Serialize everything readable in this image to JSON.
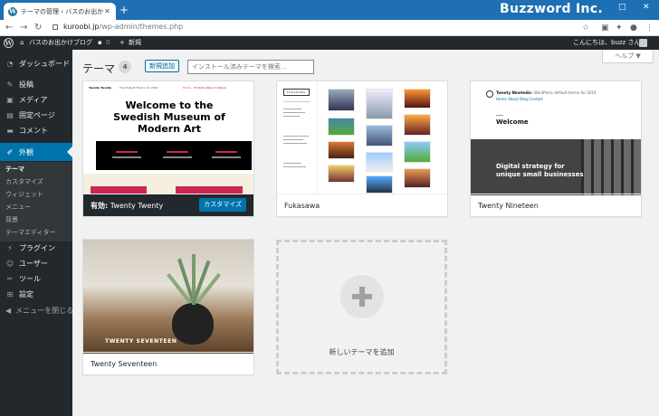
{
  "browser": {
    "tab_title": "テーマの管理 ‹ バスのお出かけブログ",
    "tab_close": "✕",
    "new_tab": "+",
    "watermark": "Buzzword Inc.",
    "url_host": "kuroobi.jp",
    "url_path": "/wp-admin/themes.php",
    "window_controls": [
      "–",
      "□",
      "✕"
    ],
    "nav_icons": [
      "back-arrow",
      "forward-arrow",
      "reload"
    ],
    "right_icons": [
      "star",
      "screenshot",
      "puzzle",
      "account",
      "kebab"
    ]
  },
  "adminbar": {
    "site_name": "バスのお出かけブログ",
    "comments_count": "0",
    "new_label": "新規",
    "greeting": "こんにちは、buzz さん"
  },
  "sidebar": {
    "items": [
      {
        "icon": "dashboard-icon",
        "glyph": "◔",
        "label": "ダッシュボード"
      },
      {
        "icon": "pin-icon",
        "glyph": "✎",
        "label": "投稿"
      },
      {
        "icon": "media-icon",
        "glyph": "▣",
        "label": "メディア"
      },
      {
        "icon": "pages-icon",
        "glyph": "▤",
        "label": "固定ページ"
      },
      {
        "icon": "comment-icon",
        "glyph": "▬",
        "label": "コメント"
      },
      {
        "icon": "brush-icon",
        "glyph": "✐",
        "label": "外観"
      },
      {
        "icon": "plugin-icon",
        "glyph": "⚡",
        "label": "プラグイン"
      },
      {
        "icon": "users-icon",
        "glyph": "☺",
        "label": "ユーザー"
      },
      {
        "icon": "tools-icon",
        "glyph": "✂",
        "label": "ツール"
      },
      {
        "icon": "settings-icon",
        "glyph": "⊞",
        "label": "設定"
      },
      {
        "icon": "collapse-icon",
        "glyph": "◀",
        "label": "メニューを閉じる"
      }
    ],
    "submenu": [
      "テーマ",
      "カスタマイズ",
      "ウィジェット",
      "メニュー",
      "背景",
      "テーマエディター"
    ]
  },
  "header": {
    "title": "テーマ",
    "count": "4",
    "add_new": "新規追加",
    "search_placeholder": "インストール済みテーマを検索...",
    "help": "ヘルプ ▼"
  },
  "themes": [
    {
      "name": "Twenty Twenty",
      "active_prefix": "有効:",
      "customize": "カスタマイズ",
      "preview_site": "Twenty Twenty",
      "preview_tagline": "The Default Theme for 2020",
      "preview_headline": "Welcome to the Swedish Museum of Modern Art",
      "preview_nav": [
        "Home",
        "Exhibitions",
        "About Us",
        "News"
      ]
    },
    {
      "name": "Fukasawa",
      "preview_logo": "FUKASAWA"
    },
    {
      "name": "Twenty Nineteen",
      "preview_site": "Twenty Nineteen",
      "preview_tagline": "— The WordPress default theme for 2019",
      "preview_nav": "Home  About  Blog  Contact",
      "preview_welcome": "Welcome",
      "preview_overlay": "Digital strategy for unique small businesses"
    },
    {
      "name": "Twenty Seventeen",
      "preview_overlay": "TWENTY SEVENTEEN"
    }
  ],
  "add_theme_label": "新しいテーマを追加"
}
